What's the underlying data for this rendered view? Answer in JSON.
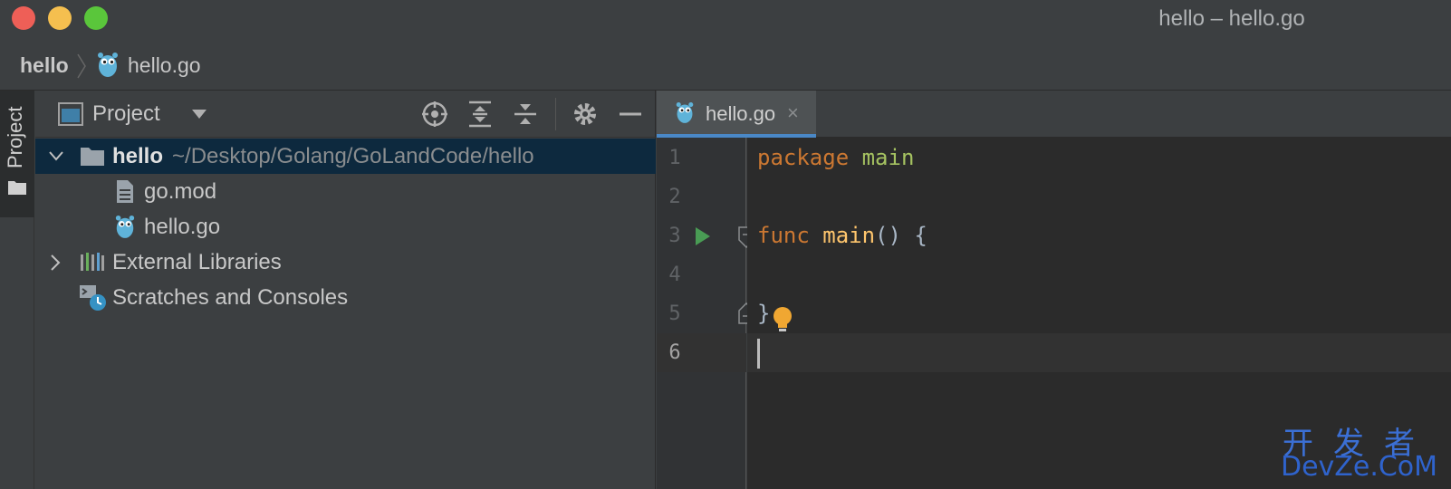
{
  "window": {
    "title": "hello – hello.go"
  },
  "breadcrumb": {
    "root": "hello",
    "file": "hello.go"
  },
  "toolstrip": {
    "project_label": "Project"
  },
  "project_panel": {
    "title": "Project",
    "tree": {
      "root_name": "hello",
      "root_path": "~/Desktop/Golang/GoLandCode/hello",
      "files": [
        "go.mod",
        "hello.go"
      ],
      "external_libraries": "External Libraries",
      "scratches": "Scratches and Consoles"
    }
  },
  "editor": {
    "tab_label": "hello.go",
    "tab_close": "×",
    "line_numbers": [
      "1",
      "2",
      "3",
      "4",
      "5",
      "6"
    ],
    "code": {
      "line1_kw": "package",
      "line1_name": "main",
      "line3_kw": "func",
      "line3_fn": "main",
      "line3_rest": "() {",
      "line5": "}"
    }
  },
  "colors": {
    "keyword": "#cc7832",
    "package_name": "#a5c261",
    "function_name": "#ffc66d",
    "run_icon": "#499c54",
    "bulb_icon": "#f0a732",
    "tab_underline": "#4a88c7",
    "selection": "#0d293e"
  },
  "watermark": {
    "line1": "开发者",
    "line2": "DevZe.CoM"
  }
}
